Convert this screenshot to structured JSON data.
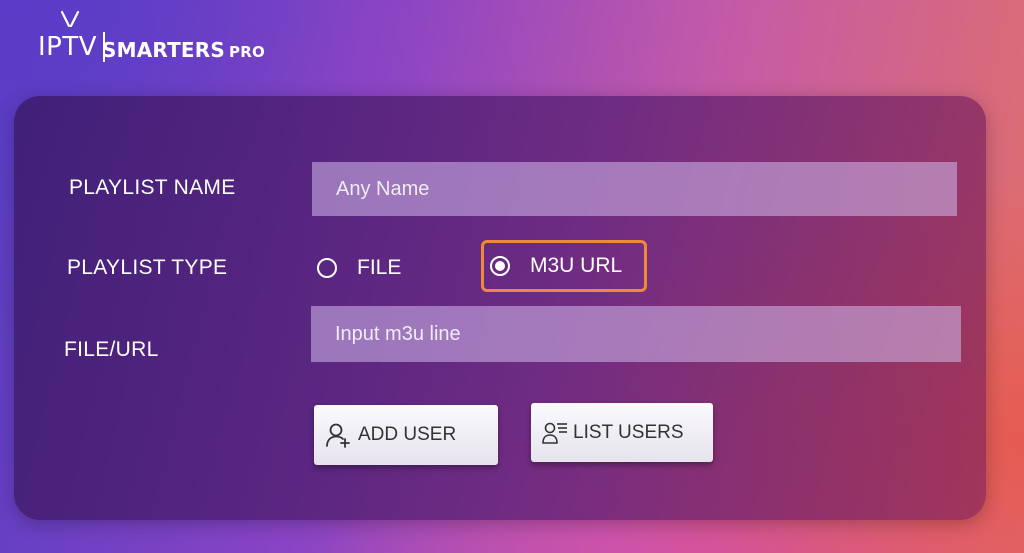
{
  "logo": {
    "iptv": "IPTV",
    "smarters": "SMARTERS",
    "pro": "PRO"
  },
  "form": {
    "playlist_name_label": "PLAYLIST NAME",
    "playlist_name_placeholder": "Any Name",
    "playlist_type_label": "PLAYLIST TYPE",
    "type_options": [
      {
        "label": "FILE",
        "selected": false
      },
      {
        "label": "M3U URL",
        "selected": true
      }
    ],
    "file_url_label": "FILE/URL",
    "file_url_placeholder": "Input m3u line"
  },
  "buttons": {
    "add_user": "ADD USER",
    "list_users": "LIST USERS"
  },
  "colors": {
    "focus_outline": "#f0883c",
    "text": "#ffffff",
    "button_text": "#333333"
  },
  "icons": {
    "add_user": "add-user-icon",
    "list_users": "list-users-icon",
    "logo": "tv-antenna-icon"
  }
}
